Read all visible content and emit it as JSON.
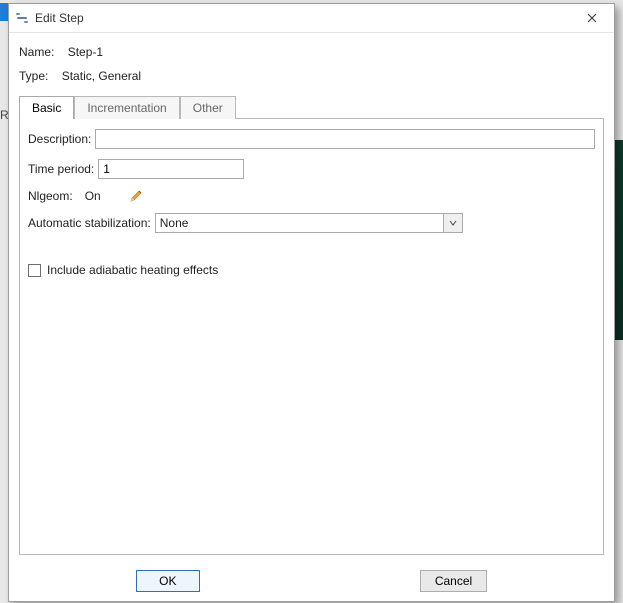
{
  "window": {
    "title": "Edit Step"
  },
  "header": {
    "name_label": "Name:",
    "name_value": "Step-1",
    "type_label": "Type:",
    "type_value": "Static, General"
  },
  "tabs": {
    "basic": "Basic",
    "incrementation": "Incrementation",
    "other": "Other"
  },
  "basic": {
    "description_label": "Description:",
    "description_value": "",
    "time_period_label": "Time period:",
    "time_period_value": "1",
    "nlgeom_label": "Nlgeom:",
    "nlgeom_value": "On",
    "stabilization_label": "Automatic stabilization:",
    "stabilization_value": "None",
    "adiabatic_label": "Include adiabatic heating effects",
    "adiabatic_checked": false
  },
  "buttons": {
    "ok": "OK",
    "cancel": "Cancel"
  }
}
